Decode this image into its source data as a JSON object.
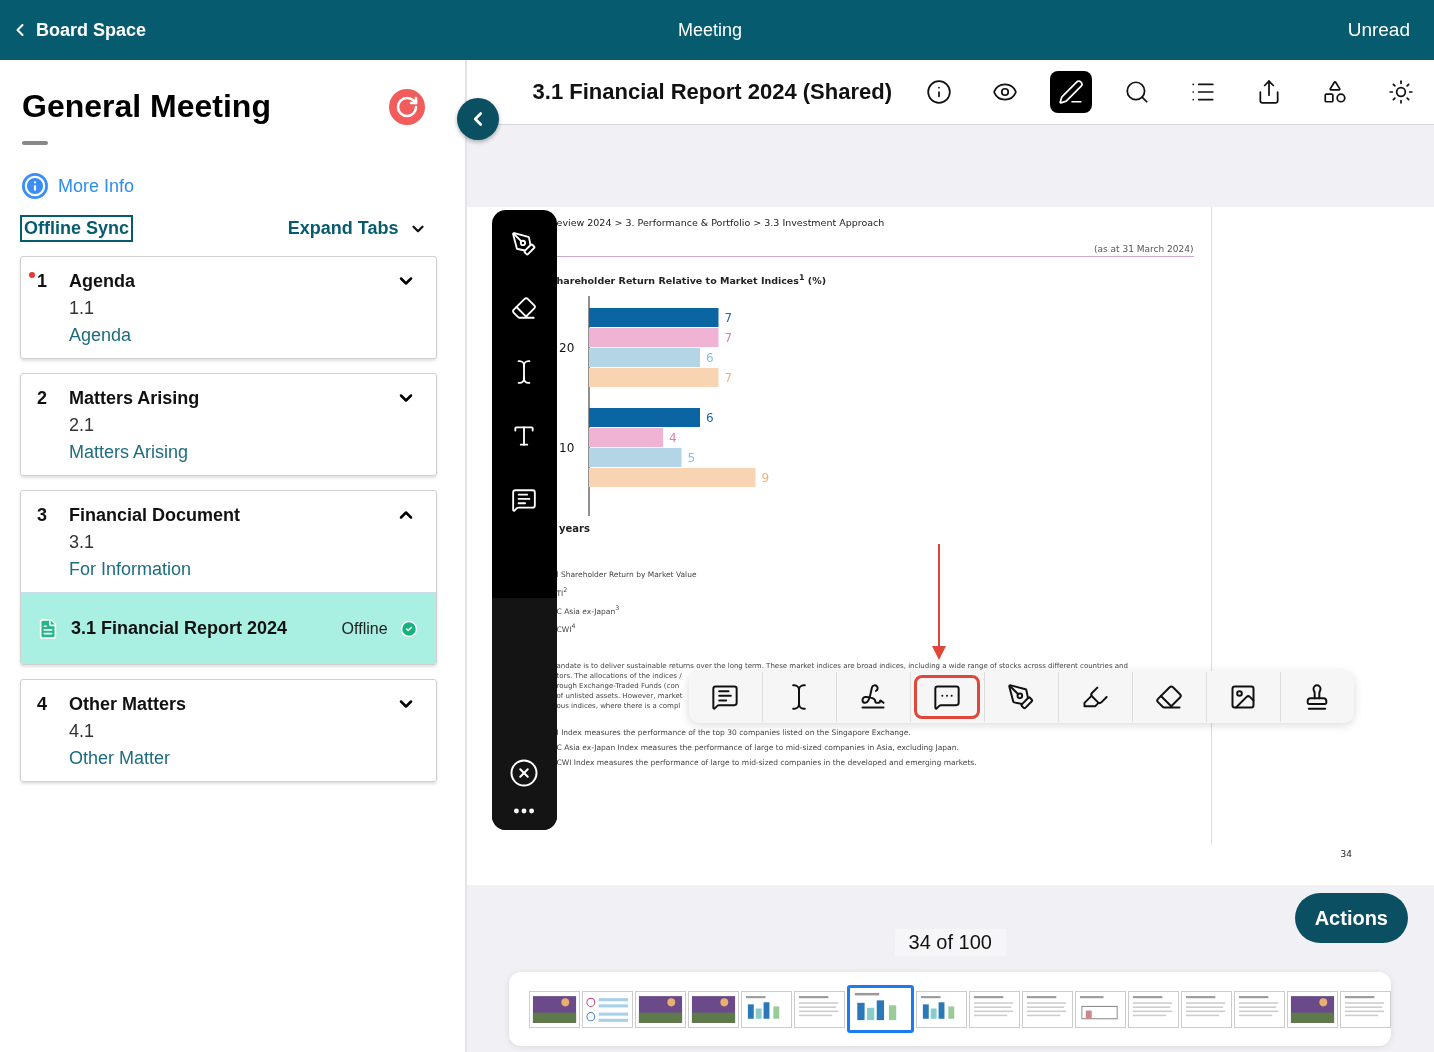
{
  "header": {
    "back_label": "Board Space",
    "title": "Meeting",
    "right_label": "Unread"
  },
  "sidebar": {
    "title": "General Meeting",
    "more_info": "More Info",
    "offline_sync": "Offline Sync",
    "expand_tabs": "Expand Tabs",
    "sections": [
      {
        "number": "1",
        "title": "Agenda",
        "unread": true,
        "expanded": false,
        "items": [
          {
            "number": "1.1",
            "title": "Agenda"
          }
        ]
      },
      {
        "number": "2",
        "title": "Matters Arising",
        "unread": false,
        "expanded": false,
        "items": [
          {
            "number": "2.1",
            "title": "Matters Arising"
          }
        ]
      },
      {
        "number": "3",
        "title": "Financial Document",
        "unread": false,
        "expanded": true,
        "items": [
          {
            "number": "3.1",
            "title": "For Information"
          }
        ],
        "documents": [
          {
            "title": "3.1 Financial Report 2024",
            "status": "Offline",
            "selected": true
          }
        ]
      },
      {
        "number": "4",
        "title": "Other Matters",
        "unread": false,
        "expanded": false,
        "items": [
          {
            "number": "4.1",
            "title": "Other Matter"
          }
        ]
      }
    ]
  },
  "viewer": {
    "title": "3.1 Financial Report 2024 (Shared)",
    "tools": [
      {
        "kind": "info",
        "selected": false
      },
      {
        "kind": "view",
        "selected": false
      },
      {
        "kind": "annotate",
        "selected": true
      },
      {
        "kind": "search",
        "selected": false
      },
      {
        "kind": "outline",
        "selected": false
      },
      {
        "kind": "share",
        "selected": false
      },
      {
        "kind": "apps",
        "selected": false
      },
      {
        "kind": "brightness",
        "selected": false
      }
    ]
  },
  "document": {
    "breadcrumb": "eview 2024 > 3. Performance & Portfolio > 3.3 Investment Approach",
    "date": "(as at 31 March 2024)",
    "chart_title": "hareholder Return Relative to Market Indices$^{1}$ (%)",
    "chart_data": {
      "type": "bar",
      "orientation": "horizontal",
      "categories": [
        "20",
        "10"
      ],
      "ylabel": "years",
      "data_labels": true,
      "series": [
        {
          "color": "#0b65a3",
          "values": [
            7,
            6
          ]
        },
        {
          "color": "#f1b3d3",
          "values": [
            7,
            4
          ]
        },
        {
          "color": "#b3d5e6",
          "values": [
            6,
            5
          ]
        },
        {
          "color": "#f9d4b2",
          "values": [
            7,
            9
          ]
        }
      ]
    },
    "legend": [
      "l Shareholder Return by Market Value",
      "TI$^{2}$",
      "C Asia ex-Japan$^{3}$",
      "CWI$^{4}$"
    ],
    "paragraph": [
      "andate is to deliver sustainable returns over the long term. These market indices are broad indices, including a wide range of stocks across different countries and",
      "tors. The allocations of the indices /",
      "rough Exchange-Traded Funds (con",
      "of unlisted assets. However, market",
      "ous indices, where there is a compl"
    ],
    "footnotes": [
      "I Index measures the performance of the top 30 companies listed on the Singapore Exchange.",
      "C Asia ex-Japan Index measures the performance of large to mid-sized companies in Asia, excluding Japan.",
      "CWI Index measures the performance of large to mid-sized companies in the developed and emerging markets."
    ],
    "page_number": "34"
  },
  "side_tools": [
    {
      "kind": "pen"
    },
    {
      "kind": "eraser"
    },
    {
      "kind": "text"
    },
    {
      "kind": "textbox"
    },
    {
      "kind": "note"
    }
  ],
  "annotation_menu": [
    {
      "kind": "note",
      "selected": false
    },
    {
      "kind": "text",
      "selected": false
    },
    {
      "kind": "signature",
      "selected": false
    },
    {
      "kind": "comment",
      "selected": true
    },
    {
      "kind": "pen",
      "selected": false
    },
    {
      "kind": "highlighter",
      "selected": false
    },
    {
      "kind": "eraser",
      "selected": false
    },
    {
      "kind": "image",
      "selected": false
    },
    {
      "kind": "stamp",
      "selected": false
    }
  ],
  "pager": "34 of 100",
  "actions": "Actions",
  "thumbnails": [
    {
      "kind": "photo",
      "selected": false
    },
    {
      "kind": "table",
      "selected": false
    },
    {
      "kind": "photo",
      "selected": false
    },
    {
      "kind": "photo",
      "selected": false
    },
    {
      "kind": "chart",
      "selected": false
    },
    {
      "kind": "text",
      "selected": false
    },
    {
      "kind": "chart",
      "selected": true
    },
    {
      "kind": "chart",
      "selected": false
    },
    {
      "kind": "text",
      "selected": false
    },
    {
      "kind": "text",
      "selected": false
    },
    {
      "kind": "diagram",
      "selected": false
    },
    {
      "kind": "text",
      "selected": false
    },
    {
      "kind": "text",
      "selected": false
    },
    {
      "kind": "text",
      "selected": false
    },
    {
      "kind": "photo",
      "selected": false
    },
    {
      "kind": "text",
      "selected": false
    }
  ]
}
